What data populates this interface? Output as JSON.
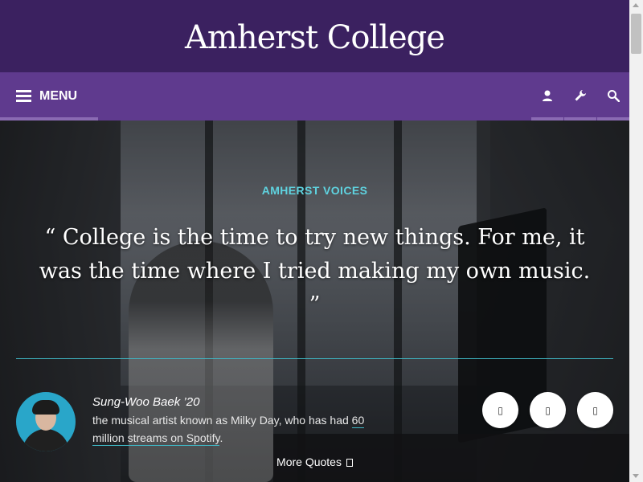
{
  "header": {
    "title": "Amherst College"
  },
  "nav": {
    "menu_label": "MENU",
    "icons": [
      "user-icon",
      "wrench-icon",
      "search-icon"
    ]
  },
  "hero": {
    "eyebrow": "AMHERST VOICES",
    "quote": "“ College is the time to try new things. For me, it was the time where I tried making my own music. ”",
    "person_name": "Sung-Woo Baek ’20",
    "desc_prefix": "the musical artist known as Milky Day, who has had ",
    "desc_link": "60 million streams on Spotify",
    "desc_suffix": ".",
    "circle_buttons": [
      "▯",
      "▯",
      "▯"
    ],
    "more_label": "More Quotes"
  },
  "colors": {
    "header_bg": "#3b2160",
    "nav_bg": "#5f3a8e",
    "accent": "#5fd3e0",
    "rule": "#3fb7c4"
  }
}
